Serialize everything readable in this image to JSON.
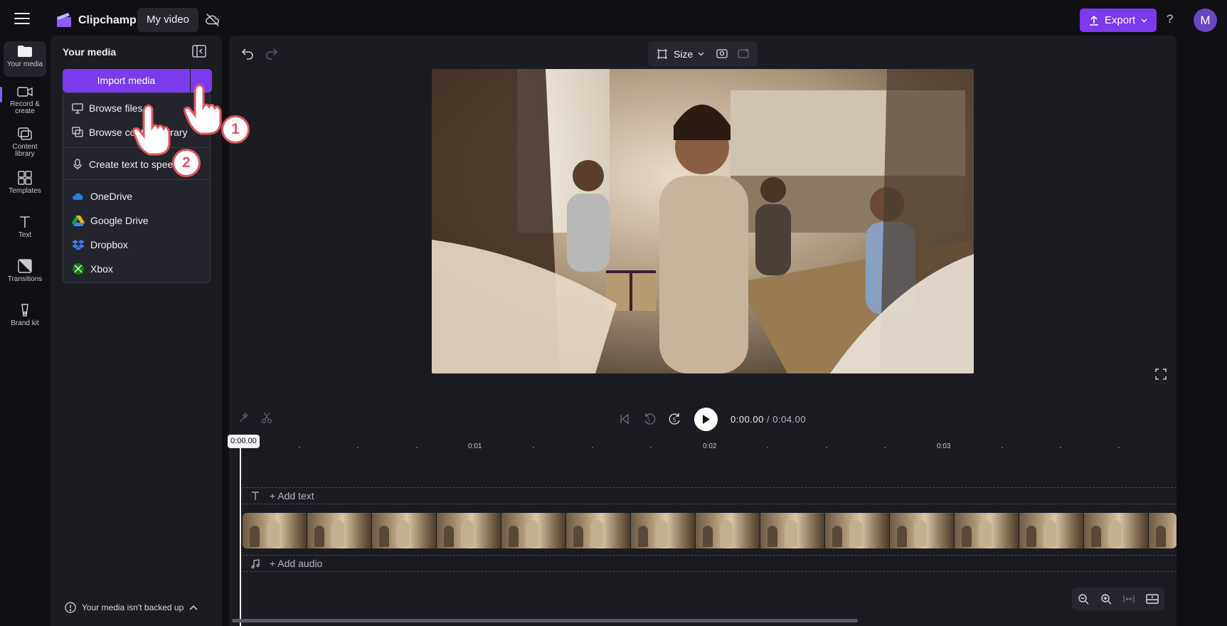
{
  "app": {
    "name": "Clipchamp",
    "project_title": "My video"
  },
  "header": {
    "export_label": "Export",
    "help_label": "?",
    "avatar_initial": "M"
  },
  "rail": {
    "items": [
      {
        "label": "Your media",
        "icon": "folder-icon"
      },
      {
        "label": "Record &",
        "label2": "create",
        "icon": "camera-icon"
      },
      {
        "label": "Content",
        "label2": "library",
        "icon": "library-icon"
      },
      {
        "label": "Templates",
        "icon": "templates-icon"
      },
      {
        "label": "Text",
        "icon": "text-icon"
      },
      {
        "label": "Transitions",
        "icon": "transitions-icon"
      },
      {
        "label": "Brand kit",
        "icon": "brand-kit-icon"
      }
    ]
  },
  "media_panel": {
    "title": "Your media",
    "import_label": "Import media",
    "backup_note": "Your media isn't backed up"
  },
  "dropdown": {
    "items": [
      {
        "label": "Browse files",
        "icon": "monitor-icon"
      },
      {
        "label": "Browse content library",
        "icon": "library-icon"
      },
      {
        "label": "Create text to speech",
        "icon": "microphone-icon"
      },
      {
        "label": "OneDrive",
        "icon": "onedrive-icon"
      },
      {
        "label": "Google Drive",
        "icon": "google-drive-icon"
      },
      {
        "label": "Dropbox",
        "icon": "dropbox-icon"
      },
      {
        "label": "Xbox",
        "icon": "xbox-icon"
      }
    ]
  },
  "preview": {
    "size_label": "Size"
  },
  "timeline": {
    "current_time": "0:00.00",
    "total_time": "0:04.00",
    "time_separator": "/",
    "playhead_label": "0:00.00",
    "ticks": [
      "0:01",
      "0:02",
      "0:03"
    ],
    "add_text": "+ Add text",
    "add_audio": "+ Add audio",
    "skip_back_seconds": "5",
    "skip_forward_seconds": "5"
  },
  "annotations": {
    "step1": "1",
    "step2": "2"
  },
  "colors": {
    "accent": "#7c3aed",
    "badge": "#e2575e"
  }
}
